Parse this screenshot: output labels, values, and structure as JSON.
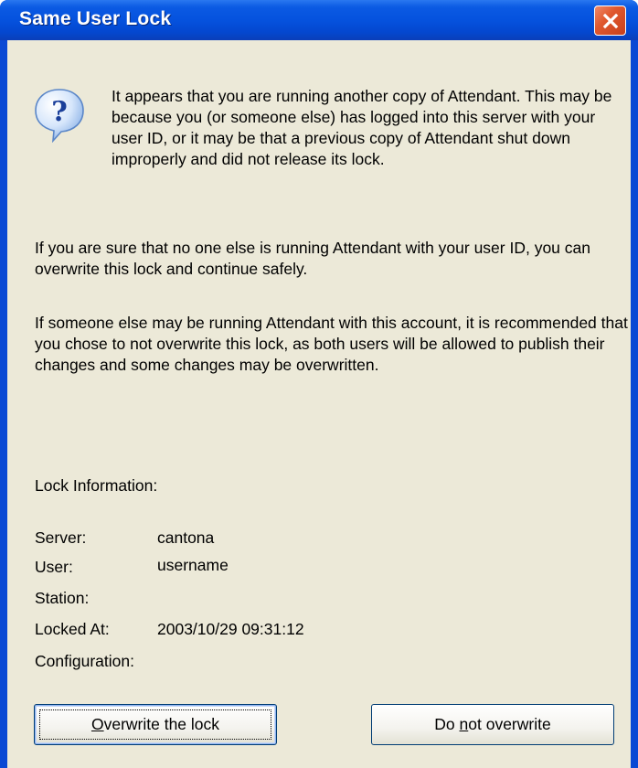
{
  "window": {
    "title": "Same User Lock"
  },
  "icons": {
    "question": "question-icon",
    "close": "close-icon"
  },
  "message": {
    "intro": "It appears that you are running another copy of Attendant.  This may be because you (or someone else) has logged into this server with your user ID, or it may be that a previous copy of Attendant shut down improperly and did not release its lock.",
    "safe_note": "If you are sure that no one else is running Attendant with your user ID, you can overwrite this lock and continue safely.",
    "warning": "If someone else may be running Attendant with this account, it is recommended that you chose to not overwrite this lock, as both users will be allowed to publish their changes and some changes may be overwritten."
  },
  "lock_info": {
    "heading": "Lock Information:",
    "server_label": "Server:",
    "server_value": "cantona",
    "user_label": "User:",
    "user_value": "username",
    "station_label": "Station:",
    "station_value": "",
    "locked_at_label": "Locked At:",
    "locked_at_value": "2003/10/29 09:31:12",
    "configuration_label": "Configuration:",
    "configuration_value": ""
  },
  "buttons": {
    "overwrite": {
      "mnemonic": "O",
      "rest": "verwrite the lock"
    },
    "do_not_overwrite": {
      "before": "Do ",
      "mnemonic": "n",
      "rest": "ot overwrite"
    }
  },
  "colors": {
    "titlebar": "#0552de",
    "client_background": "#ece9d8",
    "close_button": "#e0582e"
  }
}
